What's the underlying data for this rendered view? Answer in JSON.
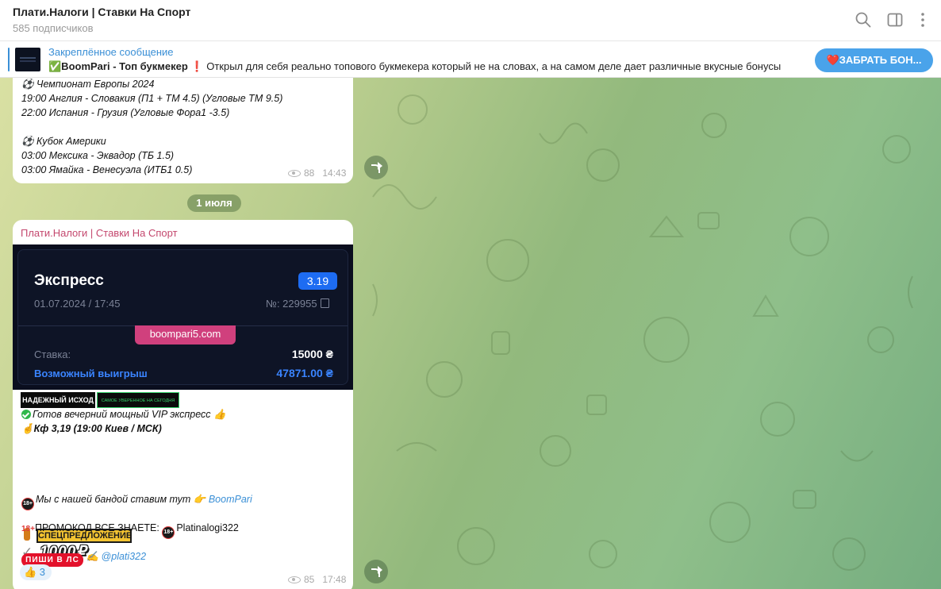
{
  "header": {
    "title": "Плати.Налоги | Ставки На Спорт",
    "subscribers": "585 подписчиков",
    "icons": [
      "search-icon",
      "sidebar-toggle-icon",
      "more-vertical-icon"
    ]
  },
  "pinned": {
    "label": "Закреплённое сообщение",
    "bold_part": "✅BoomPari - Топ букмекер",
    "rest": " ❗ Открыл для себя реально топового букмекера который не на словах, а на самом деле дает различные вкусные бонусы",
    "button": "❤️ЗАБРАТЬ БОН..."
  },
  "msg1": {
    "lines": [
      "⚽ Чемпионат Европы 2024",
      "19:00 Англия - Словакия (П1 + ТМ 4.5) (Угловые ТМ 9.5)",
      "22:00 Испания - Грузия (Угловые Фора1 -3.5)",
      "⚽ Кубок Америки",
      "03:00 Мексика - Эквадор (ТБ 1.5)",
      "03:00 Ямайка - Венесуэла (ИТБ1 0.5)"
    ],
    "views": "88",
    "time": "14:43"
  },
  "date_separator": "1 июля",
  "msg2": {
    "sender": "Плати.Налоги | Ставки На Спорт",
    "card": {
      "title": "Экспресс",
      "odds": "3.19",
      "date": "01.07.2024 / 17:45",
      "number": "№: 229955",
      "domain": "boompari5.com",
      "stake_label": "Ставка:",
      "stake_value": "15000 ₴",
      "win_label": "Возможный выигрыш",
      "win_value": "47871.00 ₴"
    },
    "badge_reliable": "НАДЕЖНЫЙ ИСХОД",
    "badge_confident": "САМОЕ УВЕРЕННОЕ НА СЕГОДНЯ",
    "line_ready": "Готов вечерний мощный VIP экспресс 👍",
    "line_kf": "Кф 3,19  (19:00 Киев / МСК)",
    "special": "СПЕЦПРЕДЛОЖЕНИЕ",
    "bonus": "1000₽",
    "line_band": "Мы с нашей бандой ставим тут 👉 ",
    "band_link": "BoomPari",
    "line_promo": "ПРОМОКОД ВСЕ ЗНАЕТЕ: ",
    "promo_code": "Platinalogi322",
    "pishi": "ПИШИ В ЛС",
    "contact": "@plati322",
    "reaction": "👍 3",
    "views": "85",
    "time": "17:48"
  },
  "colors": {
    "accent": "#3a8fd6",
    "sender": "#c4486e",
    "card_bg": "#0e1426",
    "odds_badge": "#1d6cf2",
    "domain_tag": "#d0407d"
  }
}
